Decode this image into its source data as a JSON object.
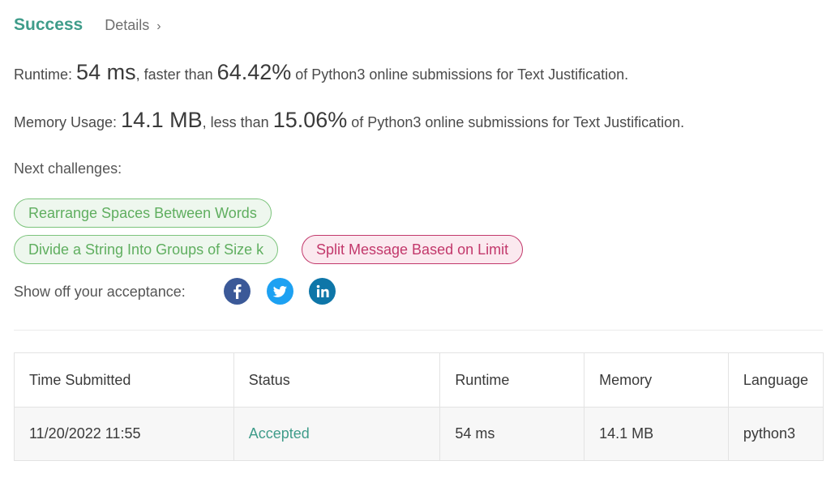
{
  "header": {
    "status": "Success",
    "details_label": "Details",
    "details_chevron": "›"
  },
  "runtime": {
    "label": "Runtime:",
    "value": "54 ms",
    "comparison": "faster than",
    "percent": "64.42%",
    "suffix": "of Python3 online submissions for Text Justification."
  },
  "memory": {
    "label": "Memory Usage:",
    "value": "14.1 MB",
    "comparison": "less than",
    "percent": "15.06%",
    "suffix": "of Python3 online submissions for Text Justification."
  },
  "next_challenges": {
    "label": "Next challenges:",
    "items": [
      {
        "title": "Rearrange Spaces Between Words",
        "difficulty": "easy"
      },
      {
        "title": "Divide a String Into Groups of Size k",
        "difficulty": "easy"
      },
      {
        "title": "Split Message Based on Limit",
        "difficulty": "hard"
      }
    ]
  },
  "share": {
    "label": "Show off your acceptance:",
    "icons": [
      "facebook-icon",
      "twitter-icon",
      "linkedin-icon"
    ],
    "colors": {
      "facebook": "#3b5998",
      "twitter": "#1da1f2",
      "linkedin": "#0e76a8"
    }
  },
  "table": {
    "headers": [
      "Time Submitted",
      "Status",
      "Runtime",
      "Memory",
      "Language"
    ],
    "rows": [
      {
        "time": "11/20/2022 11:55",
        "status": "Accepted",
        "runtime": "54 ms",
        "memory": "14.1 MB",
        "language": "python3"
      }
    ]
  },
  "colors": {
    "accent": "#3f9c8a",
    "easy": "#5fae5f",
    "hard": "#c2386b"
  }
}
